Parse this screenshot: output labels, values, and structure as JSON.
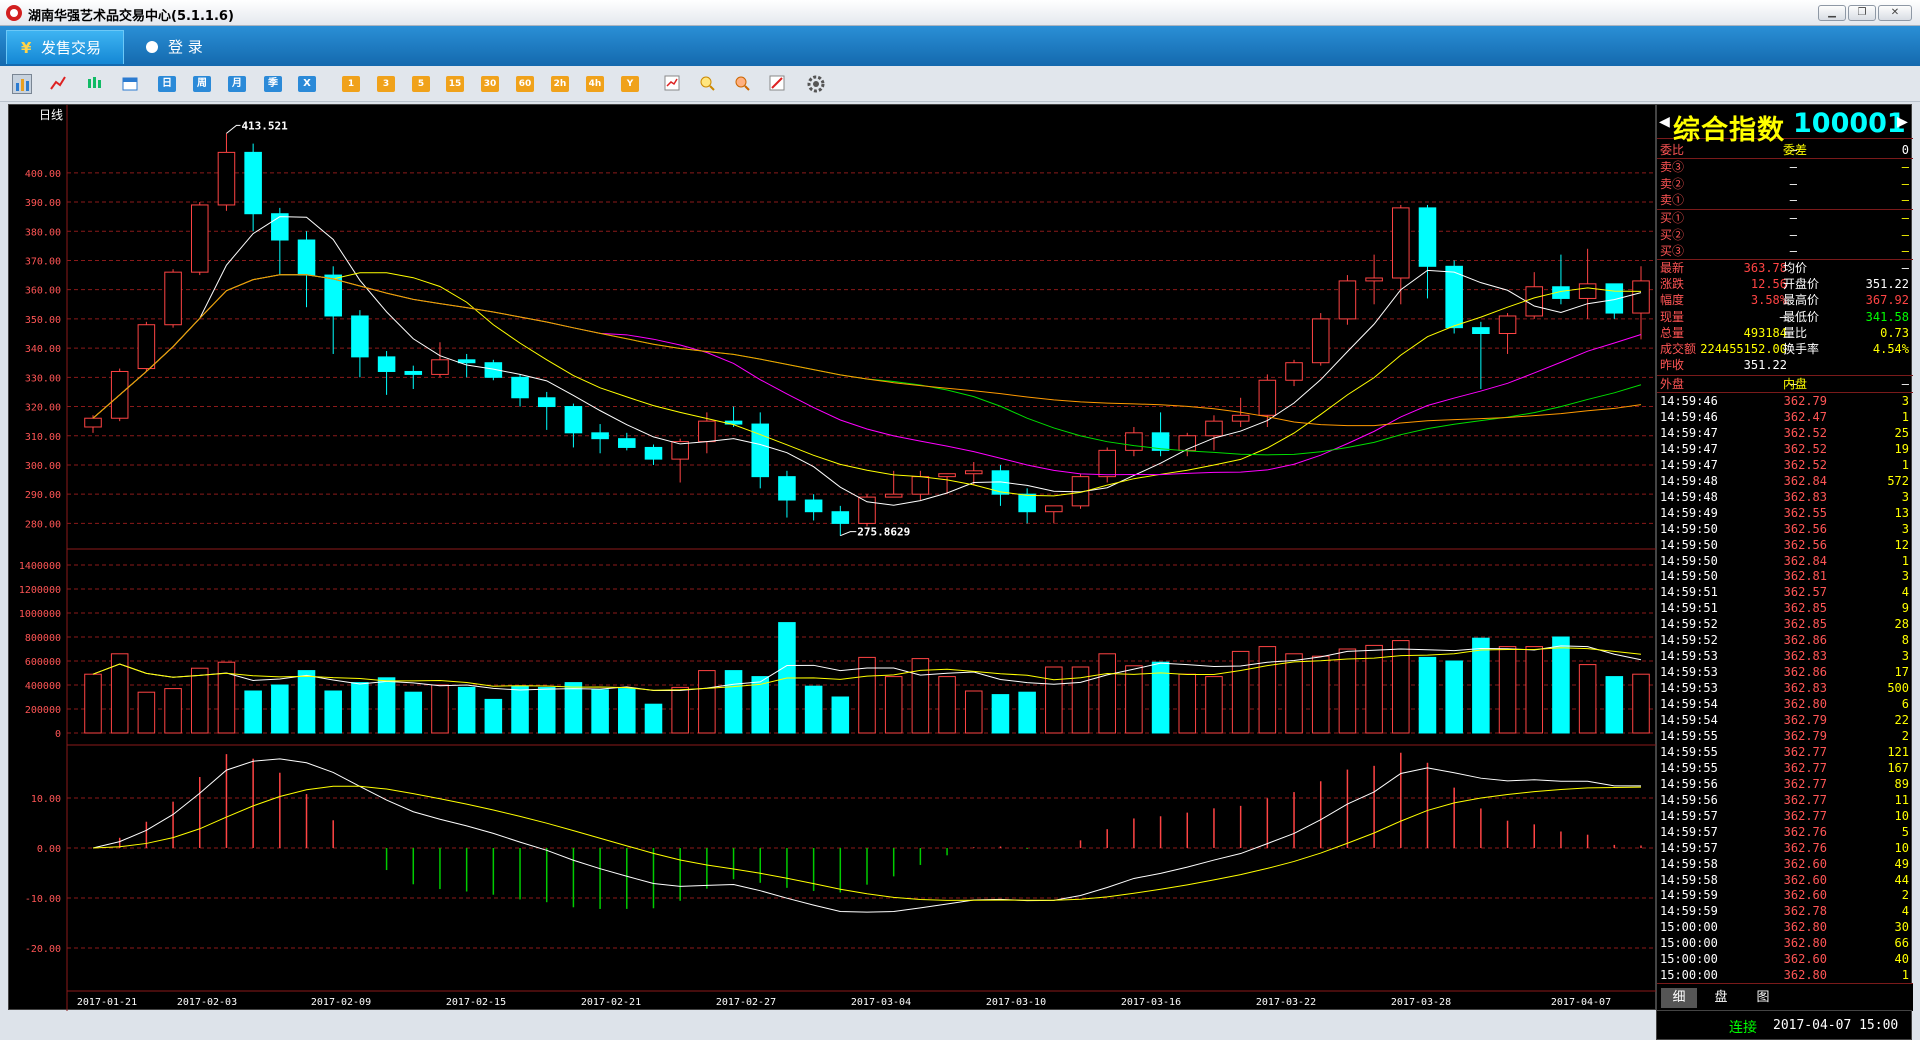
{
  "window": {
    "title": "湖南华强艺术品交易中心(5.1.1.6)"
  },
  "menu": {
    "trade_tab": "发售交易",
    "login_tab": "登  录",
    "trade_icon": "¥"
  },
  "toolbar": {
    "buttons": [
      "日",
      "周",
      "月",
      "季",
      "X",
      "1",
      "3",
      "5",
      "15",
      "30",
      "60",
      "2h",
      "4h",
      "Y"
    ]
  },
  "chart": {
    "period_label": "日线",
    "price_axis": [
      "400.00",
      "390.00",
      "380.00",
      "370.00",
      "360.00",
      "350.00",
      "340.00",
      "330.00",
      "320.00",
      "310.00",
      "300.00",
      "290.00",
      "280.00"
    ],
    "volume_axis": [
      "1400000",
      "1200000",
      "1000000",
      "800000",
      "600000",
      "400000",
      "200000",
      "0"
    ],
    "macd_axis": [
      "10.00",
      "0.00",
      "-10.00",
      "-20.00"
    ],
    "date_axis": [
      "2017-01-21",
      "2017-02-03",
      "2017-02-09",
      "2017-02-15",
      "2017-02-21",
      "2017-02-27",
      "2017-03-04",
      "2017-03-10",
      "2017-03-16",
      "2017-03-22",
      "2017-03-28",
      "2017-04-07"
    ],
    "high_label": "413.521",
    "low_label": "275.8629",
    "colors": {
      "up": "#ff4444",
      "down": "#00ffff",
      "ma_white": "#ffffff",
      "ma_yellow": "#ffff00",
      "ma_magenta": "#ff00ff",
      "ma_green": "#00dd00",
      "ma_orange": "#ff9900",
      "grid": "#8b1a1a",
      "axis_text": "#ff5555"
    }
  },
  "chart_data": {
    "type": "candlestick",
    "categories": [
      "2017-01-21",
      "2017-02-03",
      "2017-02-09",
      "2017-02-15",
      "2017-02-21",
      "2017-02-27",
      "2017-03-04",
      "2017-03-10",
      "2017-03-16",
      "2017-03-22",
      "2017-03-28",
      "2017-04-07"
    ],
    "ohlc": [
      [
        313,
        317,
        311,
        316
      ],
      [
        316,
        333,
        315,
        332
      ],
      [
        333,
        349,
        332,
        348
      ],
      [
        348,
        367,
        347,
        366
      ],
      [
        366,
        390,
        365,
        389
      ],
      [
        389,
        413.5,
        387,
        407
      ],
      [
        407,
        410,
        380,
        386
      ],
      [
        386,
        388,
        365,
        377
      ],
      [
        377,
        380,
        354,
        365
      ],
      [
        365,
        368,
        338,
        351
      ],
      [
        351,
        353,
        330,
        337
      ],
      [
        337,
        339,
        324,
        332
      ],
      [
        332,
        334,
        326,
        331
      ],
      [
        331,
        342,
        330,
        336
      ],
      [
        336,
        338,
        330,
        335
      ],
      [
        335,
        336,
        329,
        330
      ],
      [
        330,
        331,
        320,
        323
      ],
      [
        323,
        325,
        312,
        320
      ],
      [
        320,
        321,
        306,
        311
      ],
      [
        311,
        314,
        304,
        309
      ],
      [
        309,
        311,
        305,
        306
      ],
      [
        306,
        307,
        300,
        302
      ],
      [
        302,
        309,
        294,
        308
      ],
      [
        308,
        318,
        304,
        315
      ],
      [
        315,
        320,
        313,
        314
      ],
      [
        314,
        318,
        292,
        296
      ],
      [
        296,
        298,
        282,
        288
      ],
      [
        288,
        290,
        281,
        284
      ],
      [
        284,
        286,
        275.8,
        280
      ],
      [
        280,
        290,
        279,
        289
      ],
      [
        289,
        298,
        289,
        290
      ],
      [
        290,
        298,
        288,
        296
      ],
      [
        296,
        297,
        290,
        297
      ],
      [
        297,
        301,
        293,
        298
      ],
      [
        298,
        300,
        286,
        290
      ],
      [
        290,
        292,
        280,
        284
      ],
      [
        284,
        286,
        280,
        286
      ],
      [
        286,
        297,
        285,
        296
      ],
      [
        296,
        306,
        294,
        305
      ],
      [
        305,
        313,
        303,
        311
      ],
      [
        311,
        318,
        303,
        305
      ],
      [
        305,
        311,
        303,
        310
      ],
      [
        310,
        317,
        305,
        315
      ],
      [
        315,
        323,
        313,
        317
      ],
      [
        317,
        331,
        313,
        329
      ],
      [
        329,
        336,
        327,
        335
      ],
      [
        335,
        352,
        334,
        350
      ],
      [
        350,
        365,
        348,
        363
      ],
      [
        363,
        372,
        355,
        364
      ],
      [
        364,
        389,
        355,
        388
      ],
      [
        388,
        389,
        357,
        368
      ],
      [
        368,
        370,
        345,
        347
      ],
      [
        347,
        349,
        326,
        345
      ],
      [
        345,
        352,
        338,
        351
      ],
      [
        351,
        366,
        350,
        361
      ],
      [
        361,
        372,
        355,
        357
      ],
      [
        357,
        374,
        350,
        362
      ],
      [
        362,
        362,
        350,
        352
      ],
      [
        352,
        368,
        343,
        363
      ]
    ],
    "volume": [
      490000,
      660000,
      340000,
      370000,
      540000,
      590000,
      350000,
      400000,
      520000,
      350000,
      420000,
      460000,
      340000,
      400000,
      380000,
      280000,
      390000,
      380000,
      420000,
      360000,
      370000,
      240000,
      380000,
      520000,
      520000,
      470000,
      920000,
      390000,
      300000,
      630000,
      470000,
      620000,
      470000,
      350000,
      320000,
      340000,
      550000,
      550000,
      660000,
      560000,
      590000,
      490000,
      470000,
      680000,
      720000,
      660000,
      640000,
      700000,
      730000,
      770000,
      630000,
      600000,
      790000,
      720000,
      720000,
      800000,
      570000,
      470000,
      490000
    ],
    "macd_range": [
      -25,
      15
    ],
    "ylim": [
      275,
      415
    ]
  },
  "quote": {
    "name": "综合指数",
    "code": "100001",
    "wb_label": "委比",
    "wb_val": "—",
    "wc_label": "委差",
    "wc_val": "0",
    "sell": [
      {
        "l": "卖③",
        "p": "—",
        "v": "—"
      },
      {
        "l": "卖②",
        "p": "—",
        "v": "—"
      },
      {
        "l": "卖①",
        "p": "—",
        "v": "—"
      }
    ],
    "buy": [
      {
        "l": "买①",
        "p": "—",
        "v": "—"
      },
      {
        "l": "买②",
        "p": "—",
        "v": "—"
      },
      {
        "l": "买③",
        "p": "—",
        "v": "—"
      }
    ],
    "stats": [
      {
        "l": "最新",
        "v": "363.78",
        "l2": "均价",
        "v2": "—",
        "c": "#ff4444",
        "c2": "#ffffff"
      },
      {
        "l": "涨跌",
        "v": "12.56",
        "l2": "开盘价",
        "v2": "351.22",
        "c": "#ff4444",
        "c2": "#ffffff"
      },
      {
        "l": "幅度",
        "v": "3.58%",
        "l2": "最高价",
        "v2": "367.92",
        "c": "#ff4444",
        "c2": "#ff4444"
      },
      {
        "l": "现量",
        "v": "—",
        "l2": "最低价",
        "v2": "341.58",
        "c": "#ffffff",
        "c2": "#00ff00"
      },
      {
        "l": "总量",
        "v": "493184",
        "l2": "量比",
        "v2": "0.73",
        "c": "#ffff00",
        "c2": "#ffff00"
      },
      {
        "l": "成交额",
        "v": "224455152.00",
        "l2": "换手率",
        "v2": "4.54%",
        "c": "#ffff00",
        "c2": "#ffff00"
      },
      {
        "l": "昨收",
        "v": "351.22",
        "l2": "",
        "v2": "",
        "c": "#ffffff",
        "c2": "#ffffff"
      }
    ],
    "outer_label": "外盘",
    "outer_val": "—",
    "inner_label": "内盘",
    "inner_val": "—",
    "ticks": [
      [
        "14:59:46",
        "362.79",
        "3"
      ],
      [
        "14:59:46",
        "362.47",
        "1"
      ],
      [
        "14:59:47",
        "362.52",
        "25"
      ],
      [
        "14:59:47",
        "362.52",
        "19"
      ],
      [
        "14:59:47",
        "362.52",
        "1"
      ],
      [
        "14:59:48",
        "362.84",
        "572"
      ],
      [
        "14:59:48",
        "362.83",
        "3"
      ],
      [
        "14:59:49",
        "362.55",
        "13"
      ],
      [
        "14:59:50",
        "362.56",
        "3"
      ],
      [
        "14:59:50",
        "362.56",
        "12"
      ],
      [
        "14:59:50",
        "362.84",
        "1"
      ],
      [
        "14:59:50",
        "362.81",
        "3"
      ],
      [
        "14:59:51",
        "362.57",
        "4"
      ],
      [
        "14:59:51",
        "362.85",
        "9"
      ],
      [
        "14:59:52",
        "362.85",
        "28"
      ],
      [
        "14:59:52",
        "362.86",
        "8"
      ],
      [
        "14:59:53",
        "362.83",
        "3"
      ],
      [
        "14:59:53",
        "362.86",
        "17"
      ],
      [
        "14:59:53",
        "362.83",
        "500"
      ],
      [
        "14:59:54",
        "362.80",
        "6"
      ],
      [
        "14:59:54",
        "362.79",
        "22"
      ],
      [
        "14:59:55",
        "362.79",
        "2"
      ],
      [
        "14:59:55",
        "362.77",
        "121"
      ],
      [
        "14:59:55",
        "362.77",
        "167"
      ],
      [
        "14:59:56",
        "362.77",
        "89"
      ],
      [
        "14:59:56",
        "362.77",
        "11"
      ],
      [
        "14:59:57",
        "362.77",
        "10"
      ],
      [
        "14:59:57",
        "362.76",
        "5"
      ],
      [
        "14:59:57",
        "362.76",
        "10"
      ],
      [
        "14:59:58",
        "362.60",
        "49"
      ],
      [
        "14:59:58",
        "362.60",
        "44"
      ],
      [
        "14:59:59",
        "362.60",
        "2"
      ],
      [
        "14:59:59",
        "362.78",
        "4"
      ],
      [
        "15:00:00",
        "362.80",
        "30"
      ],
      [
        "15:00:00",
        "362.80",
        "66"
      ],
      [
        "15:00:00",
        "362.60",
        "40"
      ],
      [
        "15:00:00",
        "362.80",
        "1"
      ]
    ],
    "tabs": [
      "细",
      "盘",
      "图"
    ]
  },
  "status": {
    "conn": "连接",
    "time": "2017-04-07 15:00"
  }
}
